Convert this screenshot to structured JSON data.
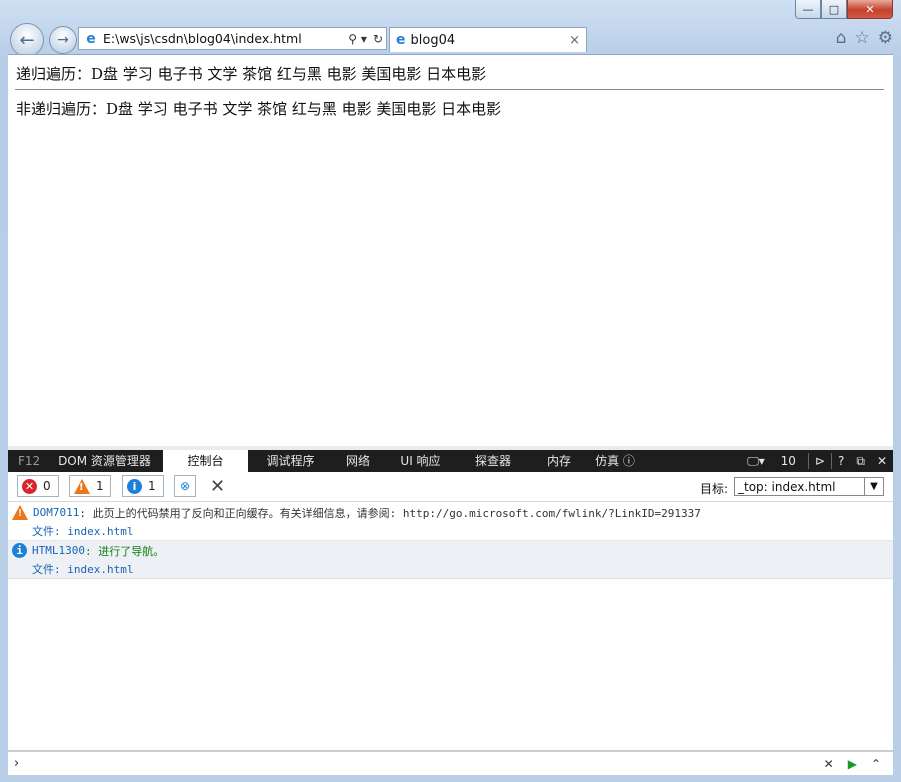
{
  "window": {
    "controls": {
      "minimize": "—",
      "maximize": "□",
      "close": "✕"
    }
  },
  "nav": {
    "back_icon": "←",
    "forward_icon": "→",
    "address": "E:\\ws\\js\\csdn\\blog04\\index.html",
    "search_icon": "⚲ ▾",
    "refresh_icon": "↻"
  },
  "tab": {
    "title": "blog04",
    "close": "×"
  },
  "toolbar_icons": {
    "home": "⌂",
    "favorites": "☆",
    "settings": "⚙"
  },
  "content": {
    "line1": "递归遍历：D盘 学习 电子书 文学 茶馆 红与黑 电影 美国电影 日本电影",
    "line2": "非递归遍历：D盘 学习 电子书 文学 茶馆 红与黑 电影 美国电影 日本电影"
  },
  "devtools": {
    "f12": "F12",
    "tabs": [
      "DOM 资源管理器",
      "控制台",
      "调试程序",
      "网络",
      "UI 响应",
      "探查器",
      "内存",
      "仿真"
    ],
    "active_tab": "控制台",
    "emulation_badge": "ⓘ",
    "doc_mode": "10",
    "right_icons": {
      "console": "⊳",
      "help": "?",
      "undock": "⧉",
      "close": "✕"
    },
    "counters": {
      "errors": "0",
      "warnings": "1",
      "info": "1"
    },
    "target_label": "目标:",
    "target_value": "_top: index.html",
    "messages": [
      {
        "type": "warning",
        "code": "DOM7011",
        "text": ": 此页上的代码禁用了反向和正向缓存。有关详细信息，请参阅: http://go.microsoft.com/fwlink/?LinkID=291337",
        "file": "文件: index.html"
      },
      {
        "type": "info",
        "code": "HTML1300",
        "text": ": 进行了导航。",
        "file": "文件: index.html"
      }
    ],
    "prompt": "›",
    "cmd_buttons": {
      "clear": "✕",
      "run": "▶",
      "expand": "⌃"
    }
  },
  "colors": {
    "error": "#d9262d",
    "warning": "#e9781c",
    "info": "#1e7fd8",
    "run": "#1a9a2a"
  }
}
